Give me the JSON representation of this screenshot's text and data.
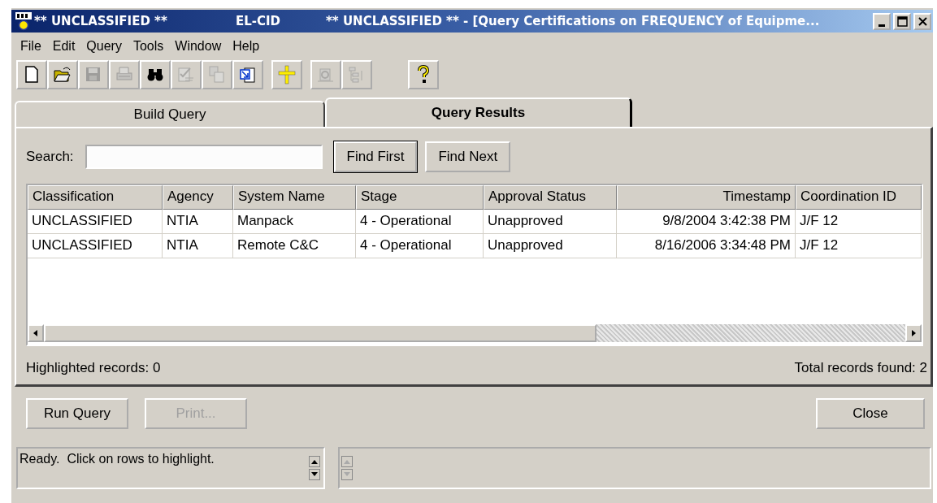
{
  "window": {
    "title_parts": [
      "** UNCLASSIFIED **",
      "EL-CID",
      "** UNCLASSIFIED ** - [Query Certifications on FREQUENCY of Equipme..."
    ]
  },
  "menu": [
    "File",
    "Edit",
    "Query",
    "Tools",
    "Window",
    "Help"
  ],
  "toolbar": [
    {
      "kind": "new",
      "disabled": false
    },
    {
      "kind": "open",
      "disabled": false
    },
    {
      "kind": "save",
      "disabled": true
    },
    {
      "kind": "print",
      "disabled": true
    },
    {
      "kind": "find",
      "disabled": false
    },
    {
      "kind": "check",
      "disabled": true
    },
    {
      "kind": "copy",
      "disabled": true
    },
    {
      "kind": "export",
      "disabled": false
    },
    {
      "kind": "plus",
      "disabled": false
    },
    {
      "kind": "gear",
      "disabled": true
    },
    {
      "kind": "tree",
      "disabled": true
    },
    {
      "kind": "help",
      "disabled": false
    }
  ],
  "tabs": [
    {
      "label": "Build Query",
      "selected": false
    },
    {
      "label": "Query Results",
      "selected": true
    }
  ],
  "search": {
    "label": "Search:",
    "buttons": [
      {
        "label": "Find First",
        "default": true
      },
      {
        "label": "Find Next",
        "default": false
      }
    ]
  },
  "table": {
    "columns": [
      {
        "label": "Classification",
        "kind": "text"
      },
      {
        "label": "Agency",
        "kind": "text"
      },
      {
        "label": "System Name",
        "kind": "text"
      },
      {
        "label": "Stage",
        "kind": "text"
      },
      {
        "label": "Approval Status",
        "kind": "text"
      },
      {
        "label": "Timestamp",
        "kind": "datetime"
      },
      {
        "label": "Coordination ID",
        "kind": "text"
      }
    ],
    "rows": [
      [
        "UNCLASSIFIED",
        "NTIA",
        "Manpack",
        "4 - Operational",
        "Unapproved",
        "9/8/2004 3:42:38 PM",
        "J/F 12"
      ],
      [
        "UNCLASSIFIED",
        "NTIA",
        "Remote C&C",
        "4 - Operational",
        "Unapproved",
        "8/16/2006 3:34:48 PM",
        "J/F 12"
      ]
    ]
  },
  "highlighted": "Highlighted records: 0",
  "total": "Total records found: 2",
  "buttons": [
    {
      "label": "Run Query",
      "disabled": false
    },
    {
      "label": "Print...",
      "disabled": true
    },
    {
      "label": "Close",
      "disabled": false
    }
  ],
  "status_bar": {
    "message": "Ready.  Click on rows to highlight."
  }
}
